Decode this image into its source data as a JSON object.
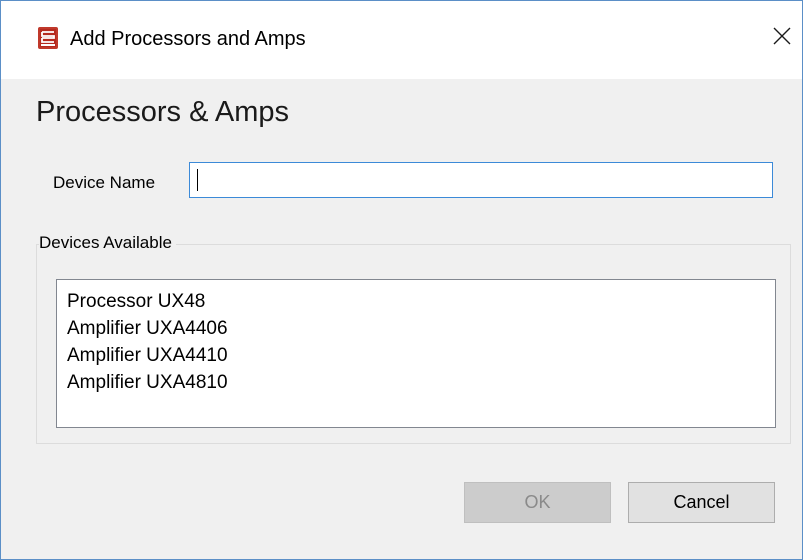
{
  "window": {
    "title": "Add Processors and Amps",
    "close_glyph": "✕"
  },
  "main": {
    "heading": "Processors & Amps",
    "device_name": {
      "label": "Device Name",
      "value": "",
      "placeholder": ""
    },
    "devices_group": {
      "legend": "Devices Available",
      "items": [
        "Processor UX48",
        "Amplifier UXA4406",
        "Amplifier UXA4410",
        "Amplifier UXA4810"
      ]
    }
  },
  "buttons": {
    "ok_label": "OK",
    "ok_enabled": false,
    "cancel_label": "Cancel"
  },
  "icons": {
    "app": "app-logo-icon",
    "close": "close-icon"
  },
  "colors": {
    "app_icon": "#c0392b",
    "input_focus_border": "#3c8ad8",
    "window_border": "#5b8fc7",
    "dialog_bg": "#f0f0f0"
  }
}
